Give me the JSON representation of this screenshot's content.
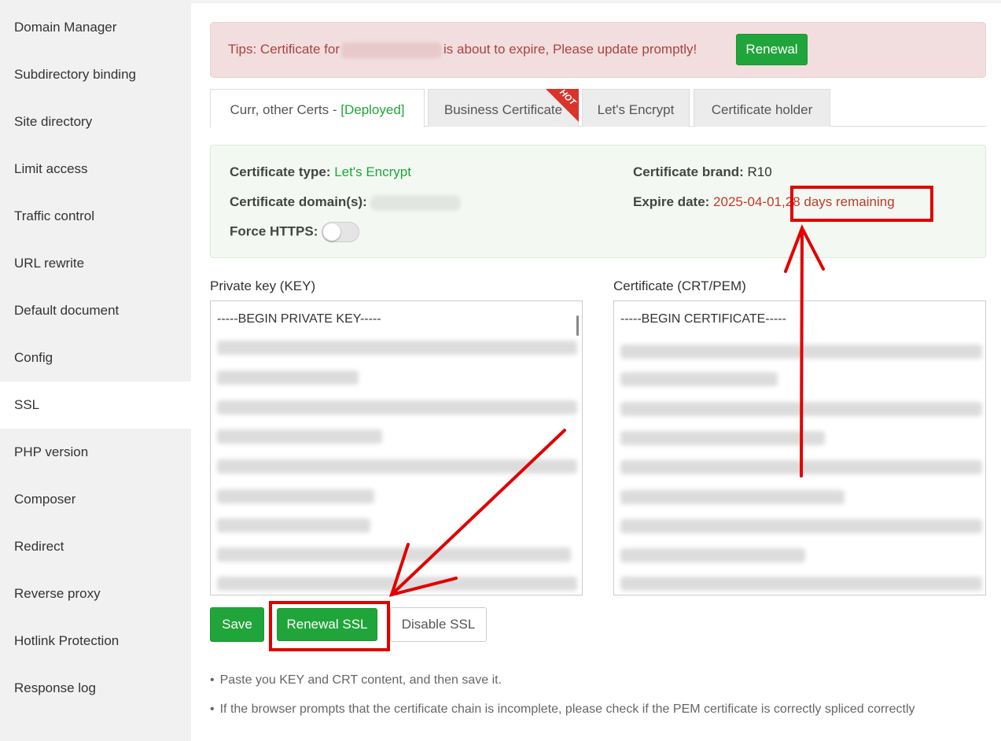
{
  "sidebar": {
    "items": [
      {
        "label": "Domain Manager"
      },
      {
        "label": "Subdirectory binding"
      },
      {
        "label": "Site directory"
      },
      {
        "label": "Limit access"
      },
      {
        "label": "Traffic control"
      },
      {
        "label": "URL rewrite"
      },
      {
        "label": "Default document"
      },
      {
        "label": "Config"
      },
      {
        "label": "SSL",
        "active": true
      },
      {
        "label": "PHP version"
      },
      {
        "label": "Composer"
      },
      {
        "label": "Redirect"
      },
      {
        "label": "Reverse proxy"
      },
      {
        "label": "Hotlink Protection"
      },
      {
        "label": "Response log"
      }
    ]
  },
  "alert": {
    "prefix": "Tips: Certificate for",
    "suffix": "is about to expire, Please update promptly!",
    "button_label": "Renewal"
  },
  "tabs": [
    {
      "label": "Curr, other Certs - ",
      "badge": "[Deployed]",
      "active": true
    },
    {
      "label": "Business Certificate",
      "hot": "HOT"
    },
    {
      "label": "Let's Encrypt"
    },
    {
      "label": "Certificate holder"
    }
  ],
  "cert_info": {
    "type_label": "Certificate type:",
    "type_value": "Let's Encrypt",
    "domains_label": "Certificate domain(s):",
    "force_https_label": "Force HTTPS:",
    "force_https_on": false,
    "brand_label": "Certificate brand:",
    "brand_value": "R10",
    "expire_label": "Expire date:",
    "expire_date": "2025-04-01,",
    "expire_remaining": "28 days remaining"
  },
  "private_key": {
    "label": "Private key (KEY)",
    "first_line": "-----BEGIN PRIVATE KEY-----"
  },
  "certificate": {
    "label": "Certificate (CRT/PEM)",
    "first_line": "-----BEGIN CERTIFICATE-----"
  },
  "actions": {
    "save_label": "Save",
    "renewal_label": "Renewal SSL",
    "disable_label": "Disable SSL"
  },
  "notes": [
    "Paste you KEY and CRT content, and then save it.",
    "If the browser prompts that the certificate chain is incomplete, please check if the PEM certificate is correctly spliced correctly"
  ],
  "colors": {
    "accent_green": "#20a53a",
    "alert_bg": "#f2dede",
    "alert_text": "#a94442",
    "annotation_red": "#e00000"
  }
}
